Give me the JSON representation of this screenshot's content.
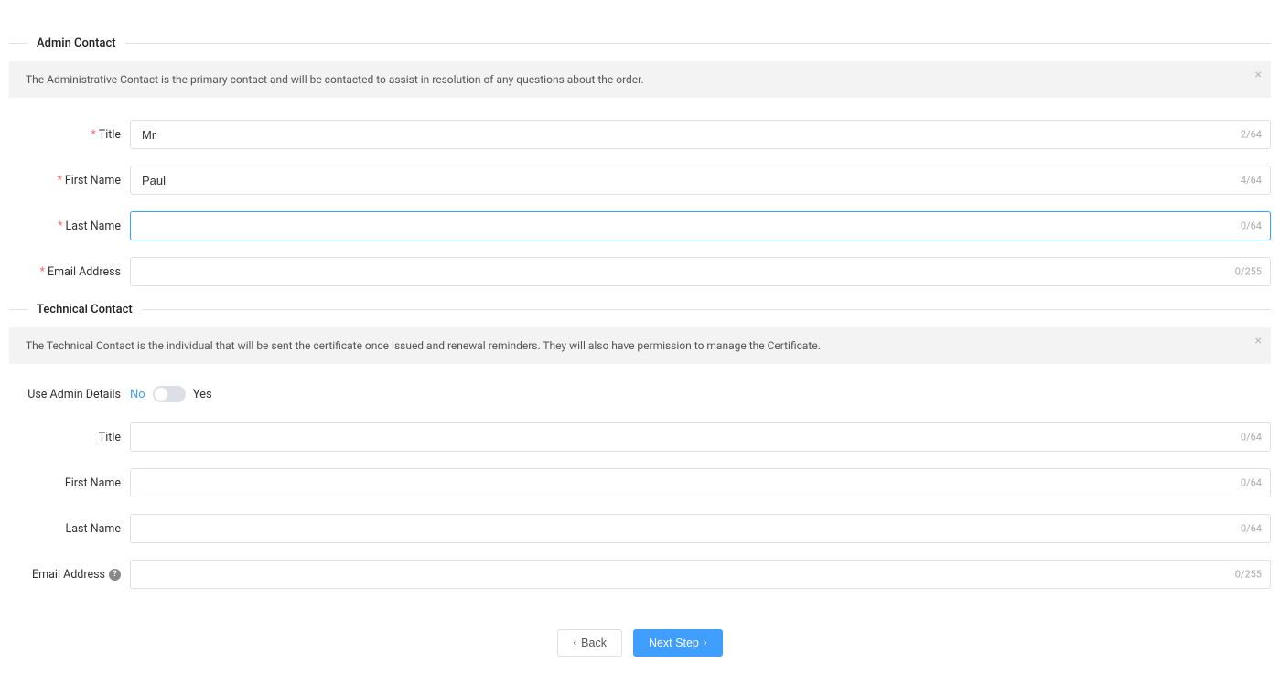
{
  "admin": {
    "section_title": "Admin Contact",
    "info": "The Administrative Contact is the primary contact and will be contacted to assist in resolution of any questions about the order.",
    "fields": {
      "title": {
        "label": "Title",
        "value": "Mr",
        "counter": "2/64",
        "required": true
      },
      "first_name": {
        "label": "First Name",
        "value": "Paul",
        "counter": "4/64",
        "required": true
      },
      "last_name": {
        "label": "Last Name",
        "value": "",
        "counter": "0/64",
        "required": true,
        "focused": true
      },
      "email": {
        "label": "Email Address",
        "value": "",
        "counter": "0/255",
        "required": true
      }
    }
  },
  "technical": {
    "section_title": "Technical Contact",
    "info": "The Technical Contact is the individual that will be sent the certificate once issued and renewal reminders. They will also have permission to manage the Certificate.",
    "use_admin_label": "Use Admin Details",
    "toggle_no": "No",
    "toggle_yes": "Yes",
    "fields": {
      "title": {
        "label": "Title",
        "value": "",
        "counter": "0/64"
      },
      "first_name": {
        "label": "First Name",
        "value": "",
        "counter": "0/64"
      },
      "last_name": {
        "label": "Last Name",
        "value": "",
        "counter": "0/64"
      },
      "email": {
        "label": "Email Address",
        "value": "",
        "counter": "0/255",
        "help": true
      }
    }
  },
  "footer": {
    "back": "Back",
    "next": "Next Step"
  }
}
